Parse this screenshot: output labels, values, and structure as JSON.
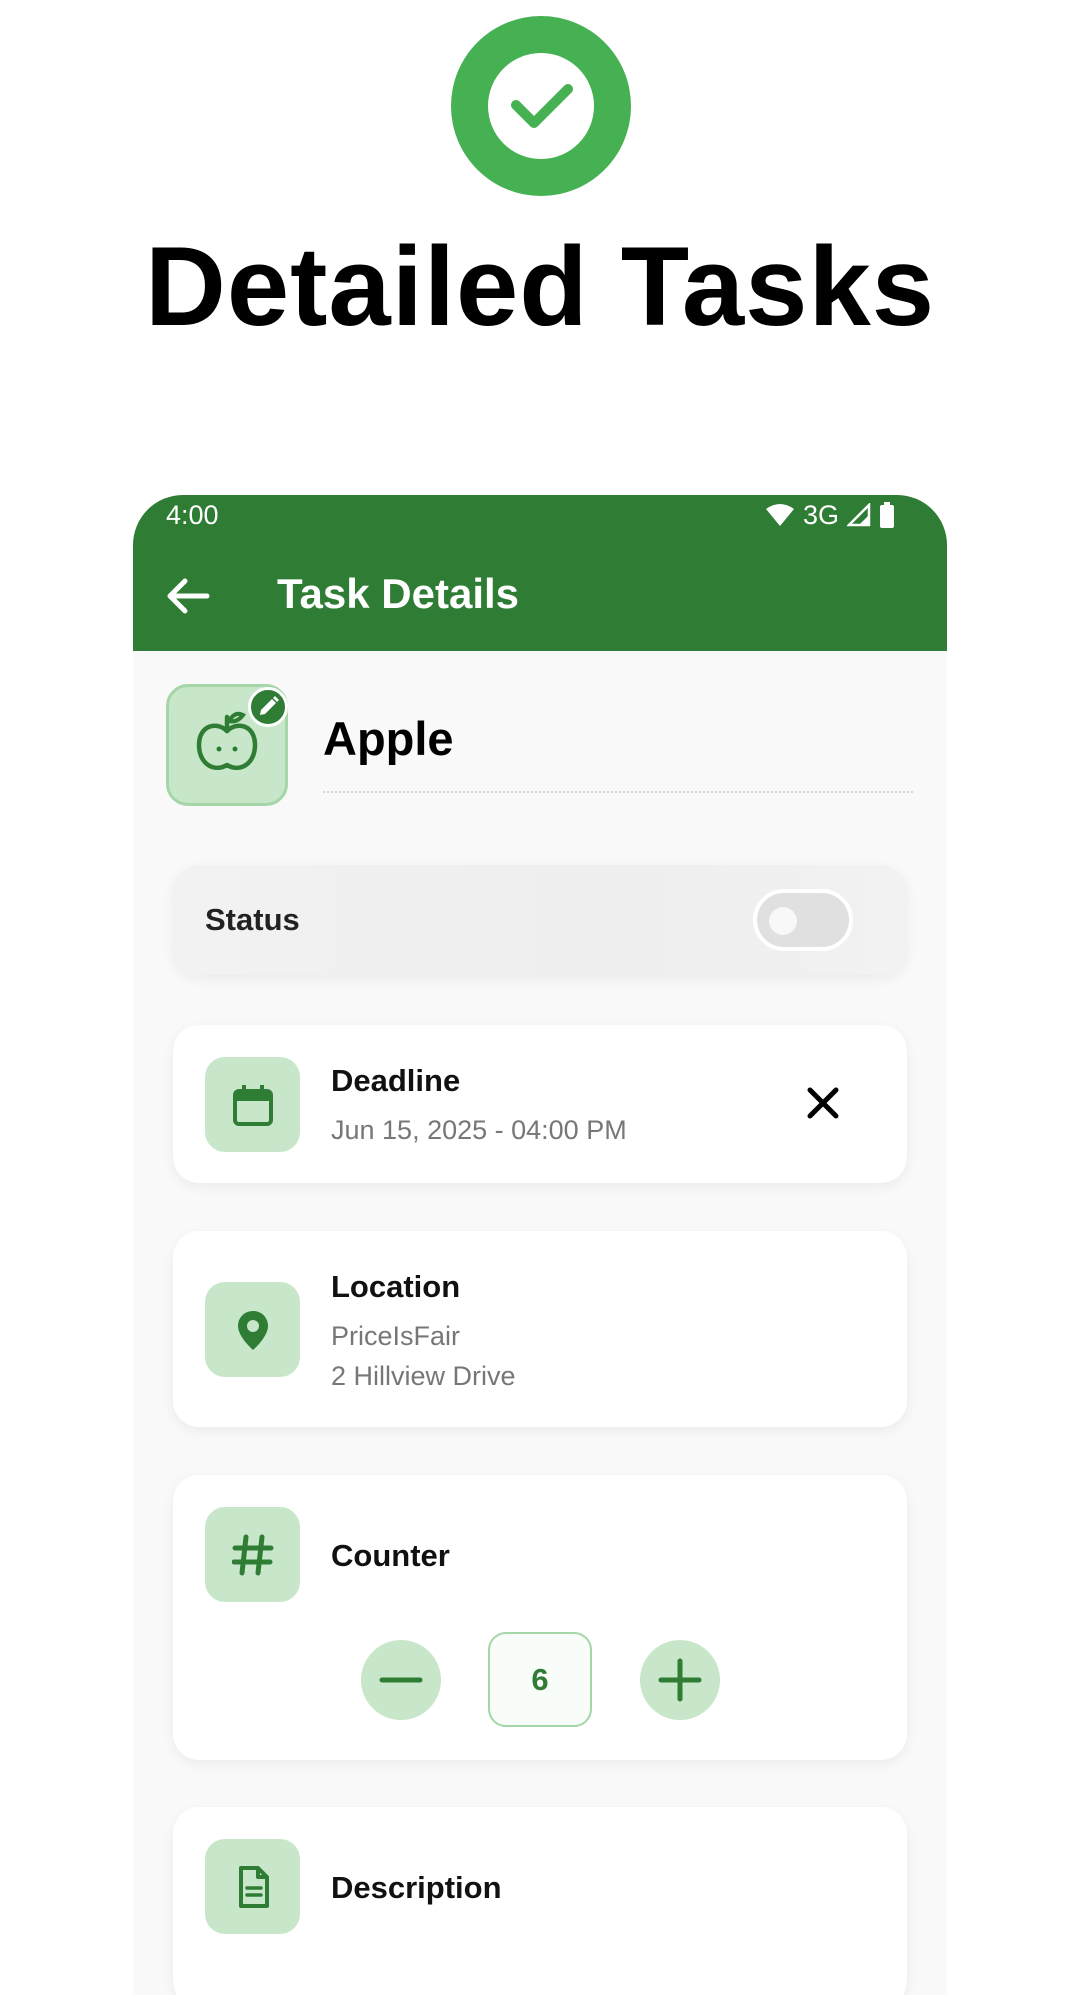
{
  "promo": {
    "title": "Detailed Tasks",
    "icon": "check-circle-icon",
    "accent_color": "#45b152"
  },
  "status_bar": {
    "time": "4:00",
    "network": "3G"
  },
  "appbar": {
    "title": "Task Details",
    "color": "#2f7d34"
  },
  "task": {
    "name": "Apple",
    "icon": "apple-icon"
  },
  "status_card": {
    "label": "Status",
    "toggled": false
  },
  "deadline_card": {
    "title": "Deadline",
    "value": "Jun 15, 2025 - 04:00 PM",
    "icon": "calendar-icon"
  },
  "location_card": {
    "title": "Location",
    "place": "PriceIsFair",
    "address": "2 Hillview Drive",
    "icon": "location-pin-icon"
  },
  "counter_card": {
    "title": "Counter",
    "value": "6",
    "icon": "hash-icon"
  },
  "description_card": {
    "title": "Description",
    "icon": "document-icon"
  }
}
